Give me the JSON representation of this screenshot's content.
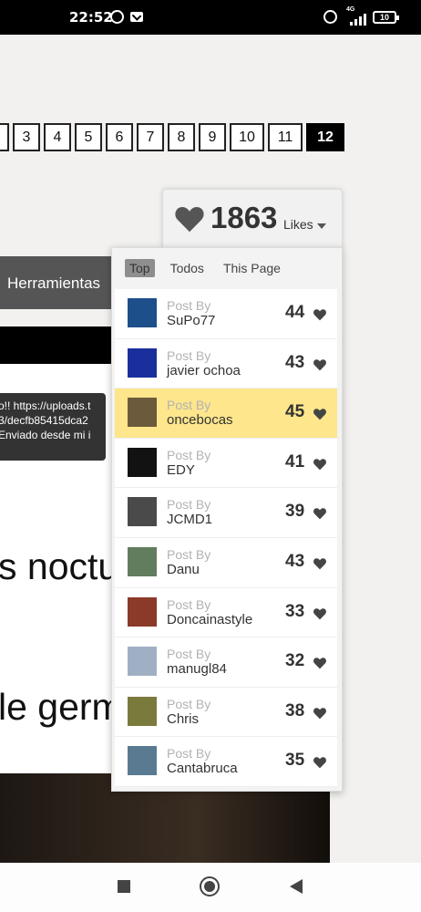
{
  "status_bar": {
    "time": "22:52",
    "network": "4G",
    "battery": "10"
  },
  "pagination": {
    "pages": [
      {
        "label": "",
        "active": false,
        "w": 20
      },
      {
        "label": "3",
        "active": false,
        "w": 30
      },
      {
        "label": "4",
        "active": false,
        "w": 30
      },
      {
        "label": "5",
        "active": false,
        "w": 30
      },
      {
        "label": "6",
        "active": false,
        "w": 30
      },
      {
        "label": "7",
        "active": false,
        "w": 30
      },
      {
        "label": "8",
        "active": false,
        "w": 30
      },
      {
        "label": "9",
        "active": false,
        "w": 30
      },
      {
        "label": "10",
        "active": false,
        "w": 38
      },
      {
        "label": "11",
        "active": false,
        "w": 38
      },
      {
        "label": "12",
        "active": true,
        "w": 42
      }
    ]
  },
  "left_content": {
    "menu_label": "Herramientas",
    "tooltip_lines": [
      "o!! https://uploads.t",
      "3/decfb85415dca2",
      " Enviado desde mi i"
    ],
    "heading_1": "s noctu",
    "heading_2": "le germ"
  },
  "likes": {
    "count": "1863",
    "label": "Likes",
    "tabs": [
      {
        "label": "Top",
        "active": true
      },
      {
        "label": "Todos",
        "active": false
      },
      {
        "label": "This Page",
        "active": false
      }
    ],
    "post_by_label": "Post By",
    "entries": [
      {
        "user": "SuPo77",
        "score": "44",
        "thumb": "#1d4f8a",
        "highlight": false
      },
      {
        "user": "javier ochoa",
        "score": "43",
        "thumb": "#1b2f9c",
        "highlight": false
      },
      {
        "user": "oncebocas",
        "score": "45",
        "thumb": "#6c5a3c",
        "highlight": true
      },
      {
        "user": "EDY",
        "score": "41",
        "thumb": "#121212",
        "highlight": false
      },
      {
        "user": "JCMD1",
        "score": "39",
        "thumb": "#4a4a4a",
        "highlight": false
      },
      {
        "user": "Danu",
        "score": "43",
        "thumb": "#627d5d",
        "highlight": false
      },
      {
        "user": "Doncainastyle",
        "score": "33",
        "thumb": "#8b3a2a",
        "highlight": false
      },
      {
        "user": "manugl84",
        "score": "32",
        "thumb": "#9fb0c4",
        "highlight": false
      },
      {
        "user": "Chris",
        "score": "38",
        "thumb": "#7b7a3d",
        "highlight": false
      },
      {
        "user": "Cantabruca",
        "score": "35",
        "thumb": "#5a7a92",
        "highlight": false
      }
    ]
  },
  "colors": {
    "highlight": "#fde68c",
    "active_page": "#000000",
    "menu_bg": "#555555"
  },
  "icons": [
    "whatsapp-icon",
    "mail-icon",
    "alarm-icon",
    "signal-icon",
    "battery-icon",
    "heart-icon",
    "caret-down-icon",
    "recent-apps-icon",
    "home-icon",
    "back-icon"
  ]
}
